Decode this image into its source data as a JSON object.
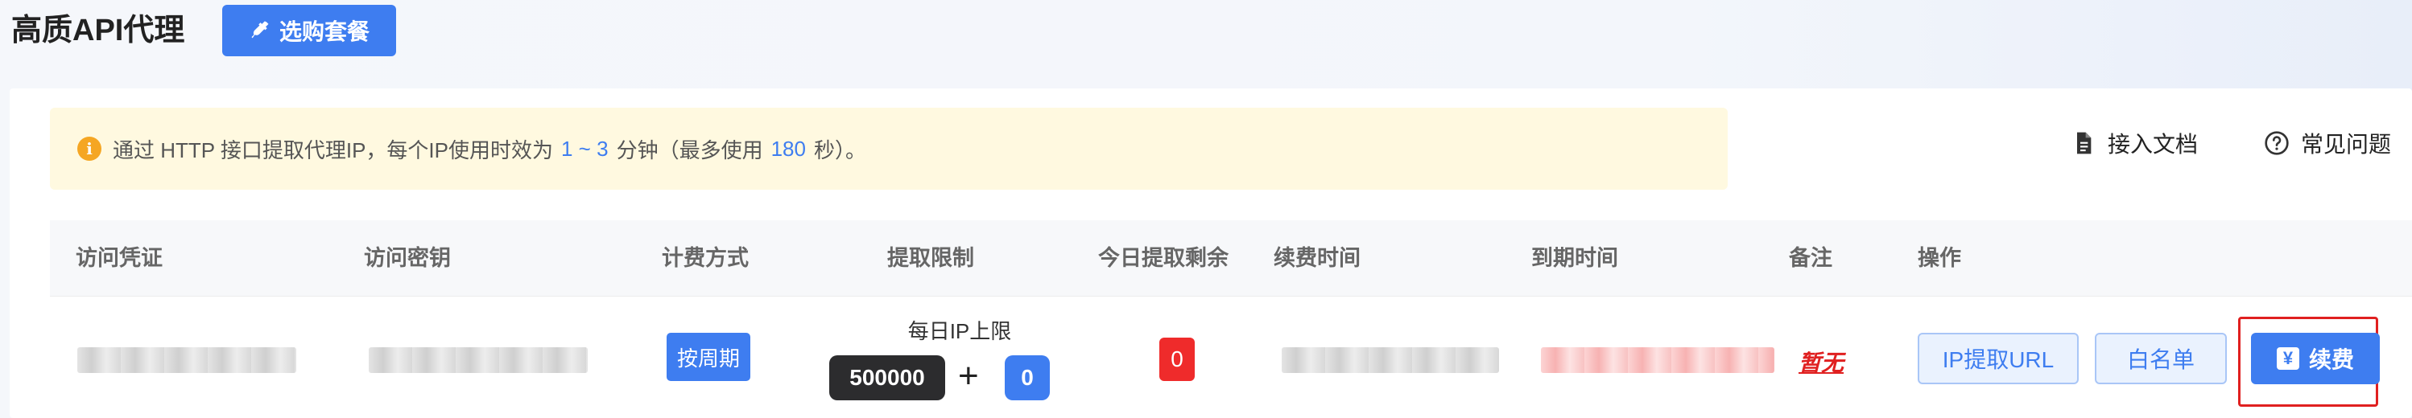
{
  "header": {
    "title": "高质API代理",
    "buy_label": "选购套餐"
  },
  "notice": {
    "text_before": "通过 HTTP 接口提取代理IP，每个IP使用时效为",
    "duration": "1 ~ 3",
    "text_middle": "分钟（最多使用",
    "max_seconds": "180",
    "text_after": "秒）。"
  },
  "links": {
    "docs": "接入文档",
    "faq": "常见问题"
  },
  "table": {
    "headers": [
      "访问凭证",
      "访问密钥",
      "计费方式",
      "提取限制",
      "今日提取剩余",
      "续费时间",
      "到期时间",
      "备注",
      "操作"
    ],
    "rows": [
      {
        "billing": "按周期",
        "limit_title": "每日IP上限",
        "limit_max": "500000",
        "limit_plus": "+",
        "limit_extra": "0",
        "remaining": "0",
        "note": "暂无",
        "actions": {
          "extract_url": "IP提取URL",
          "whitelist": "白名单",
          "renew": "续费"
        }
      }
    ]
  },
  "colors": {
    "primary": "#3e7df0",
    "danger": "#ef2b2b",
    "notice_bg": "#fff9e0",
    "warning": "#f5a623"
  }
}
